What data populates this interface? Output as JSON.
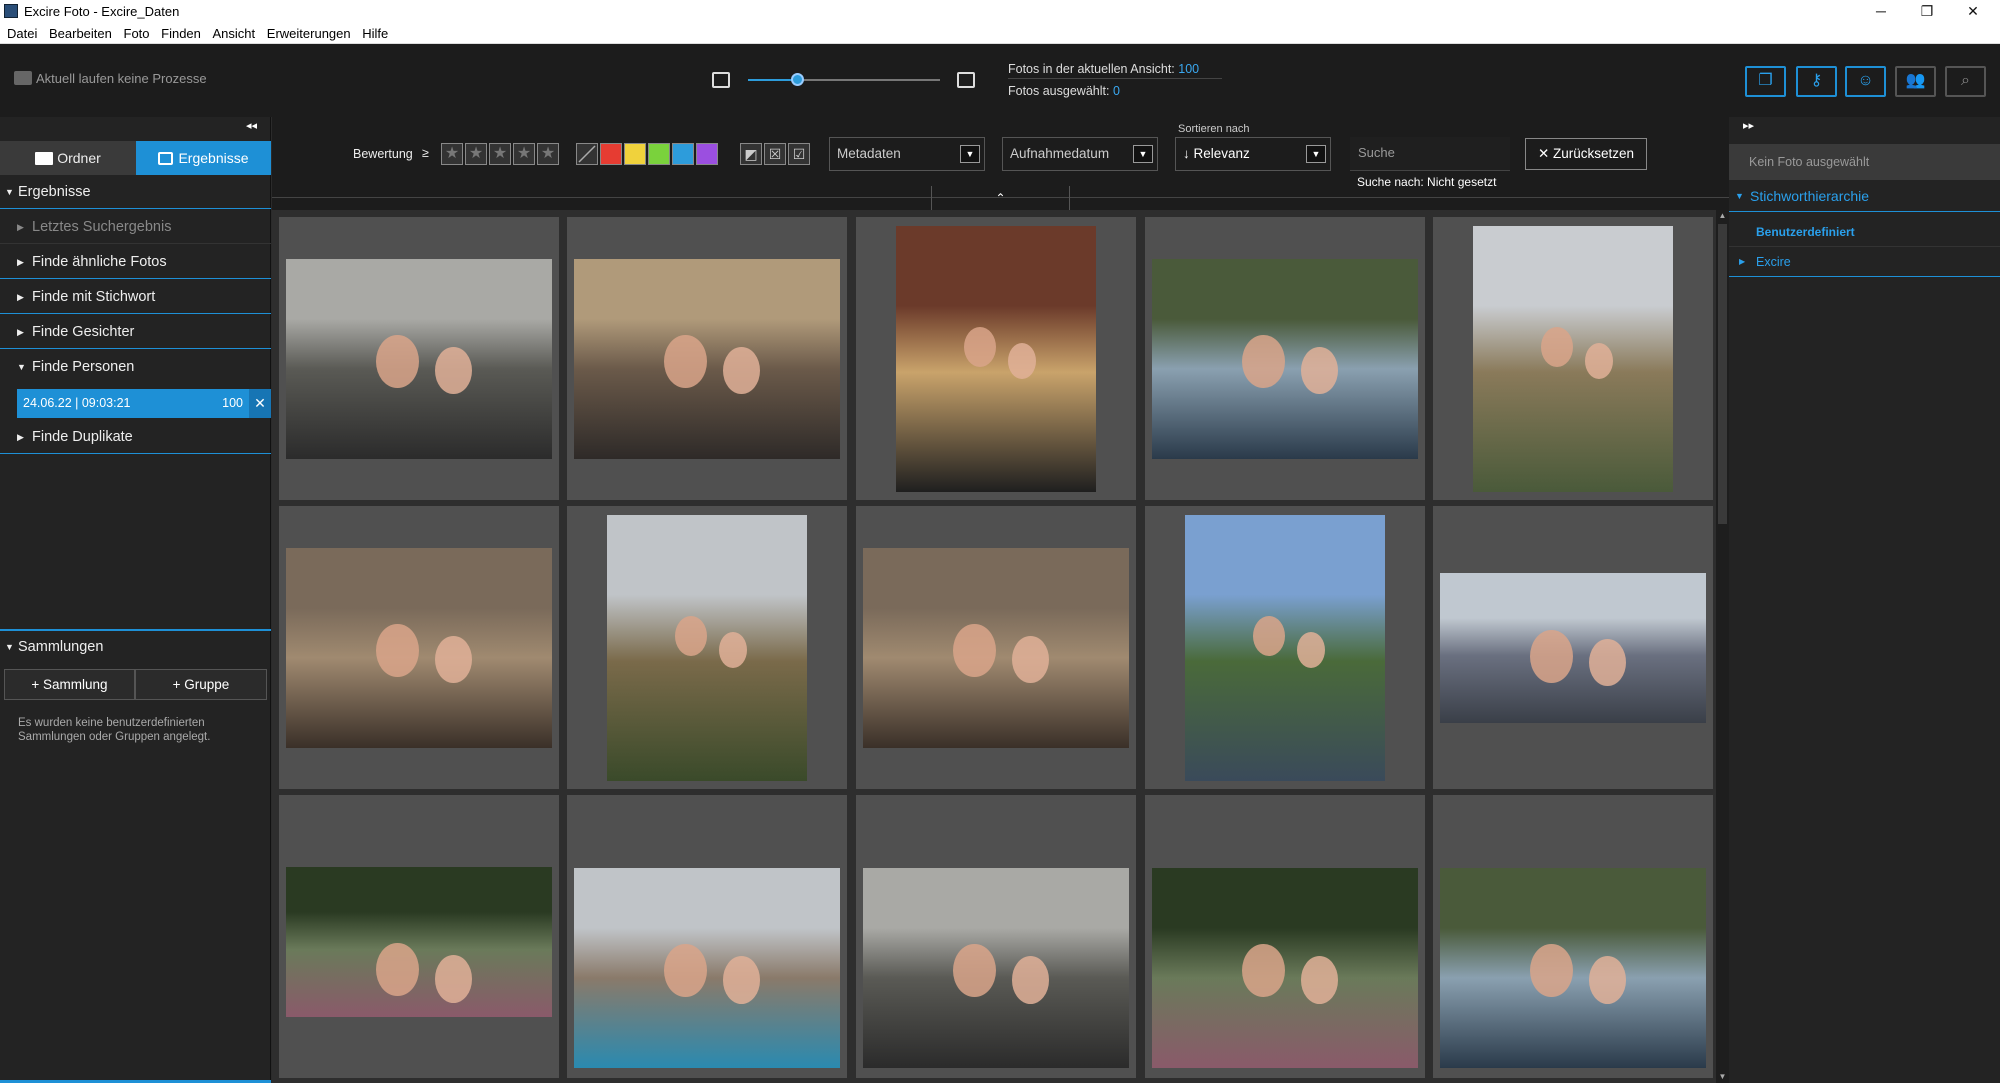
{
  "window": {
    "title": "Excire Foto - Excire_Daten",
    "minimize": "─",
    "maximize": "❐",
    "close": "✕"
  },
  "menu": [
    "Datei",
    "Bearbeiten",
    "Foto",
    "Finden",
    "Ansicht",
    "Erweiterungen",
    "Hilfe"
  ],
  "toolbar": {
    "process_status": "Aktuell laufen keine Prozesse",
    "zoom_level": 0.26,
    "stats_view_label": "Fotos in der aktuellen Ansicht:",
    "stats_view_value": "100",
    "stats_selected_label": "Fotos ausgewählt:",
    "stats_selected_value": "0",
    "buttons": [
      {
        "name": "collections-icon",
        "glyph": "❐"
      },
      {
        "name": "key-icon",
        "glyph": "⚷"
      },
      {
        "name": "face-icon",
        "glyph": "☺"
      },
      {
        "name": "people-icon",
        "glyph": "👥"
      },
      {
        "name": "search-icon",
        "glyph": "⌕"
      }
    ]
  },
  "left": {
    "collapse": "◂◂",
    "tab_folder": "Ordner",
    "tab_results": "Ergebnisse",
    "section_results": "Ergebnisse",
    "items": [
      "Letztes Suchergebnis",
      "Finde ähnliche Fotos",
      "Finde mit Stichwort",
      "Finde Gesichter",
      "Finde Personen",
      "Finde Duplikate"
    ],
    "result_entry": {
      "label": "24.06.22 | 09:03:21",
      "count": "100",
      "remove": "✕"
    },
    "section_collections": "Sammlungen",
    "btn_collection": "+ Sammlung",
    "btn_group": "+ Gruppe",
    "note": "Es wurden keine benutzerdefinierten Sammlungen oder Gruppen angelegt."
  },
  "filter": {
    "rating_label": "Bewertung",
    "rating_op": "≥",
    "stars": [
      "★",
      "★",
      "★",
      "★",
      "★"
    ],
    "colors": [
      "#e63c32",
      "#f0d23c",
      "#7ad23c",
      "#2d9cdb",
      "#9b4fe0"
    ],
    "flags": [
      "◩",
      "☒",
      "☑"
    ],
    "metadata": "Metadaten",
    "capture_date": "Aufnahmedatum",
    "sort_label": "Sortieren nach",
    "sort_value": "↓ Relevanz",
    "search_placeholder": "Suche",
    "reset": "✕ Zurücksetzen",
    "search_status": "Suche nach: Nicht gesetzt",
    "collapse_up": "⌃"
  },
  "right": {
    "expand": "▸▸",
    "no_photo": "Kein Foto ausgewählt",
    "keyword_hierarchy": "Stichworthierarchie",
    "custom": "Benutzerdefiniert",
    "excire": "Excire"
  },
  "photos": [
    {
      "orientation": "landscape",
      "colors": [
        "#a9a9a5",
        "#5a5a55",
        "#2b2b2b"
      ]
    },
    {
      "orientation": "landscape",
      "colors": [
        "#b09a7a",
        "#6b5a4a",
        "#2e2a28"
      ]
    },
    {
      "orientation": "portrait",
      "colors": [
        "#6b3a2a",
        "#c9a36b",
        "#1f1f1f"
      ]
    },
    {
      "orientation": "landscape",
      "colors": [
        "#4a5a3a",
        "#8aa0b0",
        "#2a3a4a"
      ]
    },
    {
      "orientation": "portrait",
      "colors": [
        "#c9ccd0",
        "#8a7a5a",
        "#4a5a3a"
      ]
    },
    {
      "orientation": "landscape",
      "colors": [
        "#7a6a5a",
        "#a08a70",
        "#3a3028"
      ]
    },
    {
      "orientation": "portrait",
      "colors": [
        "#c0c4c8",
        "#7a6a4a",
        "#3a4a2a"
      ]
    },
    {
      "orientation": "landscape",
      "colors": [
        "#7a6a5a",
        "#a08a70",
        "#3a3028"
      ]
    },
    {
      "orientation": "portrait",
      "colors": [
        "#7aa0d0",
        "#4a6a3a",
        "#3a4a5a"
      ]
    },
    {
      "orientation": "landscape",
      "colors": [
        "#c0c8d0",
        "#6a7080",
        "#3a3f48"
      ]
    },
    {
      "orientation": "landscape",
      "colors": [
        "#2a3a22",
        "#6a7a5a",
        "#8a5a6a"
      ]
    },
    {
      "orientation": "landscape",
      "colors": [
        "#c0c4c8",
        "#8a7a6a",
        "#2a8ab0"
      ]
    },
    {
      "orientation": "landscape",
      "colors": [
        "#a9a9a5",
        "#5a5a55",
        "#2b2b2b"
      ]
    },
    {
      "orientation": "landscape",
      "colors": [
        "#2a3a22",
        "#6a7a5a",
        "#8a5a6a"
      ]
    },
    {
      "orientation": "landscape",
      "colors": [
        "#4a5a3a",
        "#8aa0b0",
        "#2a3a4a"
      ]
    }
  ]
}
